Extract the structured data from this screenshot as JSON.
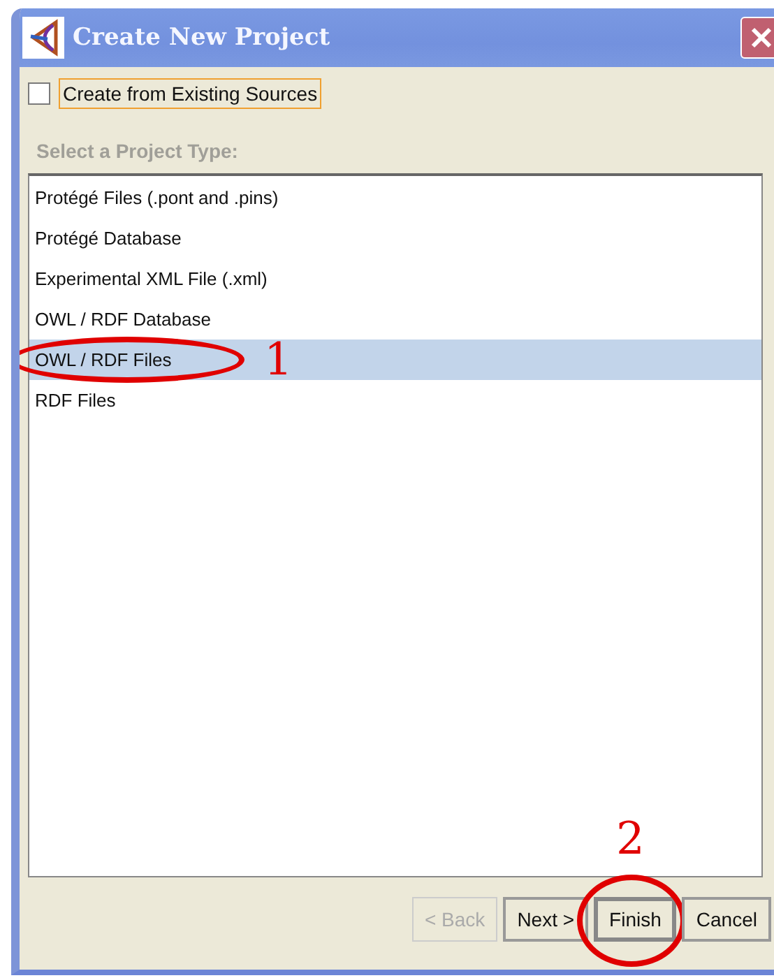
{
  "window": {
    "title": "Create New Project"
  },
  "existing_sources": {
    "label": "Create from Existing Sources",
    "checked": false
  },
  "list_heading": "Select a Project Type:",
  "project_types": [
    {
      "label": "Protégé Files (.pont and .pins)",
      "selected": false
    },
    {
      "label": "Protégé Database",
      "selected": false
    },
    {
      "label": "Experimental XML File (.xml)",
      "selected": false
    },
    {
      "label": "OWL / RDF Database",
      "selected": false
    },
    {
      "label": "OWL / RDF Files",
      "selected": true
    },
    {
      "label": "RDF Files",
      "selected": false
    }
  ],
  "buttons": [
    {
      "label": "< Back",
      "disabled": true,
      "focused": false
    },
    {
      "label": "Next >",
      "disabled": false,
      "focused": false
    },
    {
      "label": "Finish",
      "disabled": false,
      "focused": true
    },
    {
      "label": "Cancel",
      "disabled": false,
      "focused": false
    }
  ],
  "annotations": [
    {
      "kind": "ellipse",
      "label": "1"
    },
    {
      "kind": "circle",
      "label": "2"
    }
  ]
}
